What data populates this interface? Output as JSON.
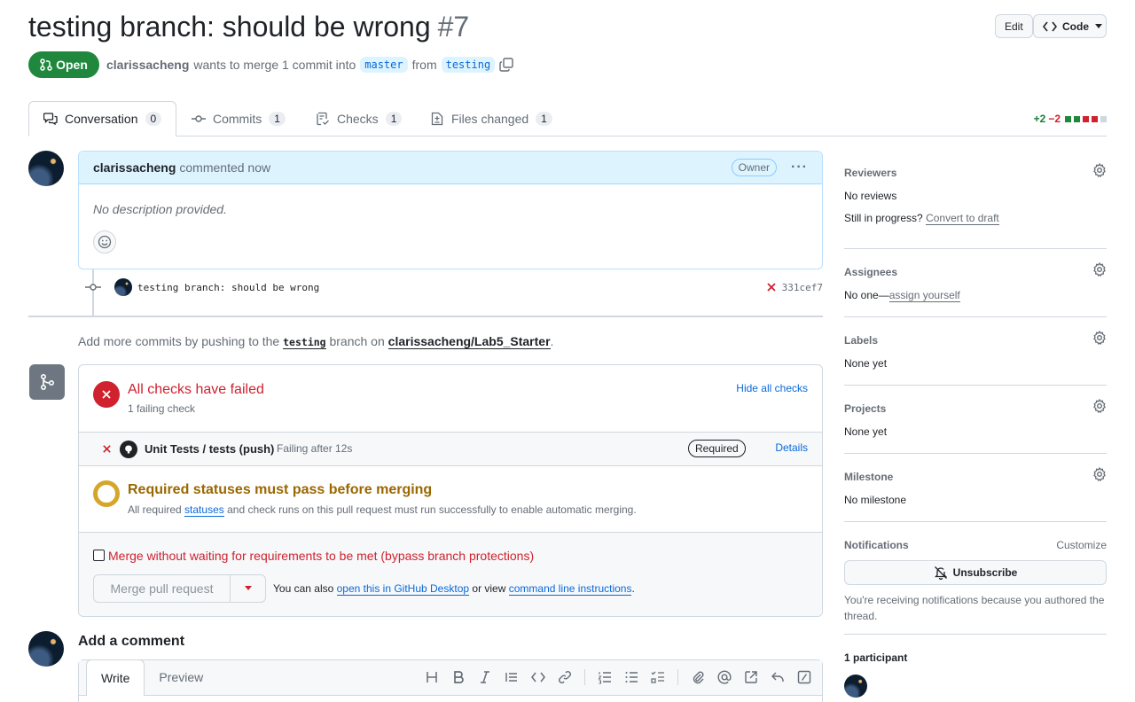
{
  "header": {
    "title": "testing branch: should be wrong",
    "number": "#7",
    "edit_label": "Edit",
    "code_label": "Code",
    "state_label": "Open",
    "author": "clarissacheng",
    "merge_text": "wants to merge 1 commit into",
    "base_branch": "master",
    "from_text": "from",
    "head_branch": "testing"
  },
  "tabs": [
    {
      "label": "Conversation",
      "count": "0"
    },
    {
      "label": "Commits",
      "count": "1"
    },
    {
      "label": "Checks",
      "count": "1"
    },
    {
      "label": "Files changed",
      "count": "1"
    }
  ],
  "diffstat": {
    "additions": "+2",
    "deletions": "−2"
  },
  "comment": {
    "author": "clarissacheng",
    "time": "commented now",
    "badge": "Owner",
    "body": "No description provided."
  },
  "commit": {
    "message": "testing branch: should be wrong",
    "sha": "331cef7"
  },
  "hint": {
    "prefix": "Add more commits by pushing to the",
    "branch": "testing",
    "middle": "branch on",
    "repo": "clarissacheng/Lab5_Starter",
    "suffix": "."
  },
  "merge": {
    "checks_title": "All checks have failed",
    "checks_sub": "1 failing check",
    "hide_label": "Hide all checks",
    "check_name": "Unit Tests / tests (push)",
    "check_status": "Failing after 12s",
    "required_label": "Required",
    "details_label": "Details",
    "req_title": "Required statuses must pass before merging",
    "req_pre": "All required",
    "req_link": "statuses",
    "req_post": "and check runs on this pull request must run successfully to enable automatic merging.",
    "bypass_label": "Merge without waiting for requirements to be met (bypass branch protections)",
    "merge_button": "Merge pull request",
    "also_pre": "You can also",
    "also_link1": "open this in GitHub Desktop",
    "also_mid": "or view",
    "also_link2": "command line instructions",
    "also_post": "."
  },
  "add_comment": {
    "title": "Add a comment",
    "write_tab": "Write",
    "preview_tab": "Preview"
  },
  "sidebar": {
    "reviewers": {
      "title": "Reviewers",
      "value": "No reviews",
      "progress": "Still in progress?",
      "draft_link": "Convert to draft"
    },
    "assignees": {
      "title": "Assignees",
      "value": "No one—",
      "link": "assign yourself"
    },
    "labels": {
      "title": "Labels",
      "value": "None yet"
    },
    "projects": {
      "title": "Projects",
      "value": "None yet"
    },
    "milestone": {
      "title": "Milestone",
      "value": "No milestone"
    },
    "notifications": {
      "title": "Notifications",
      "customize": "Customize",
      "unsubscribe": "Unsubscribe",
      "reason": "You're receiving notifications because you authored the thread."
    },
    "participants": {
      "title": "1 participant"
    }
  },
  "colors": {
    "green": "#1f883d",
    "red": "#cf222e",
    "blue": "#0969da",
    "yellow": "#bf8700"
  }
}
